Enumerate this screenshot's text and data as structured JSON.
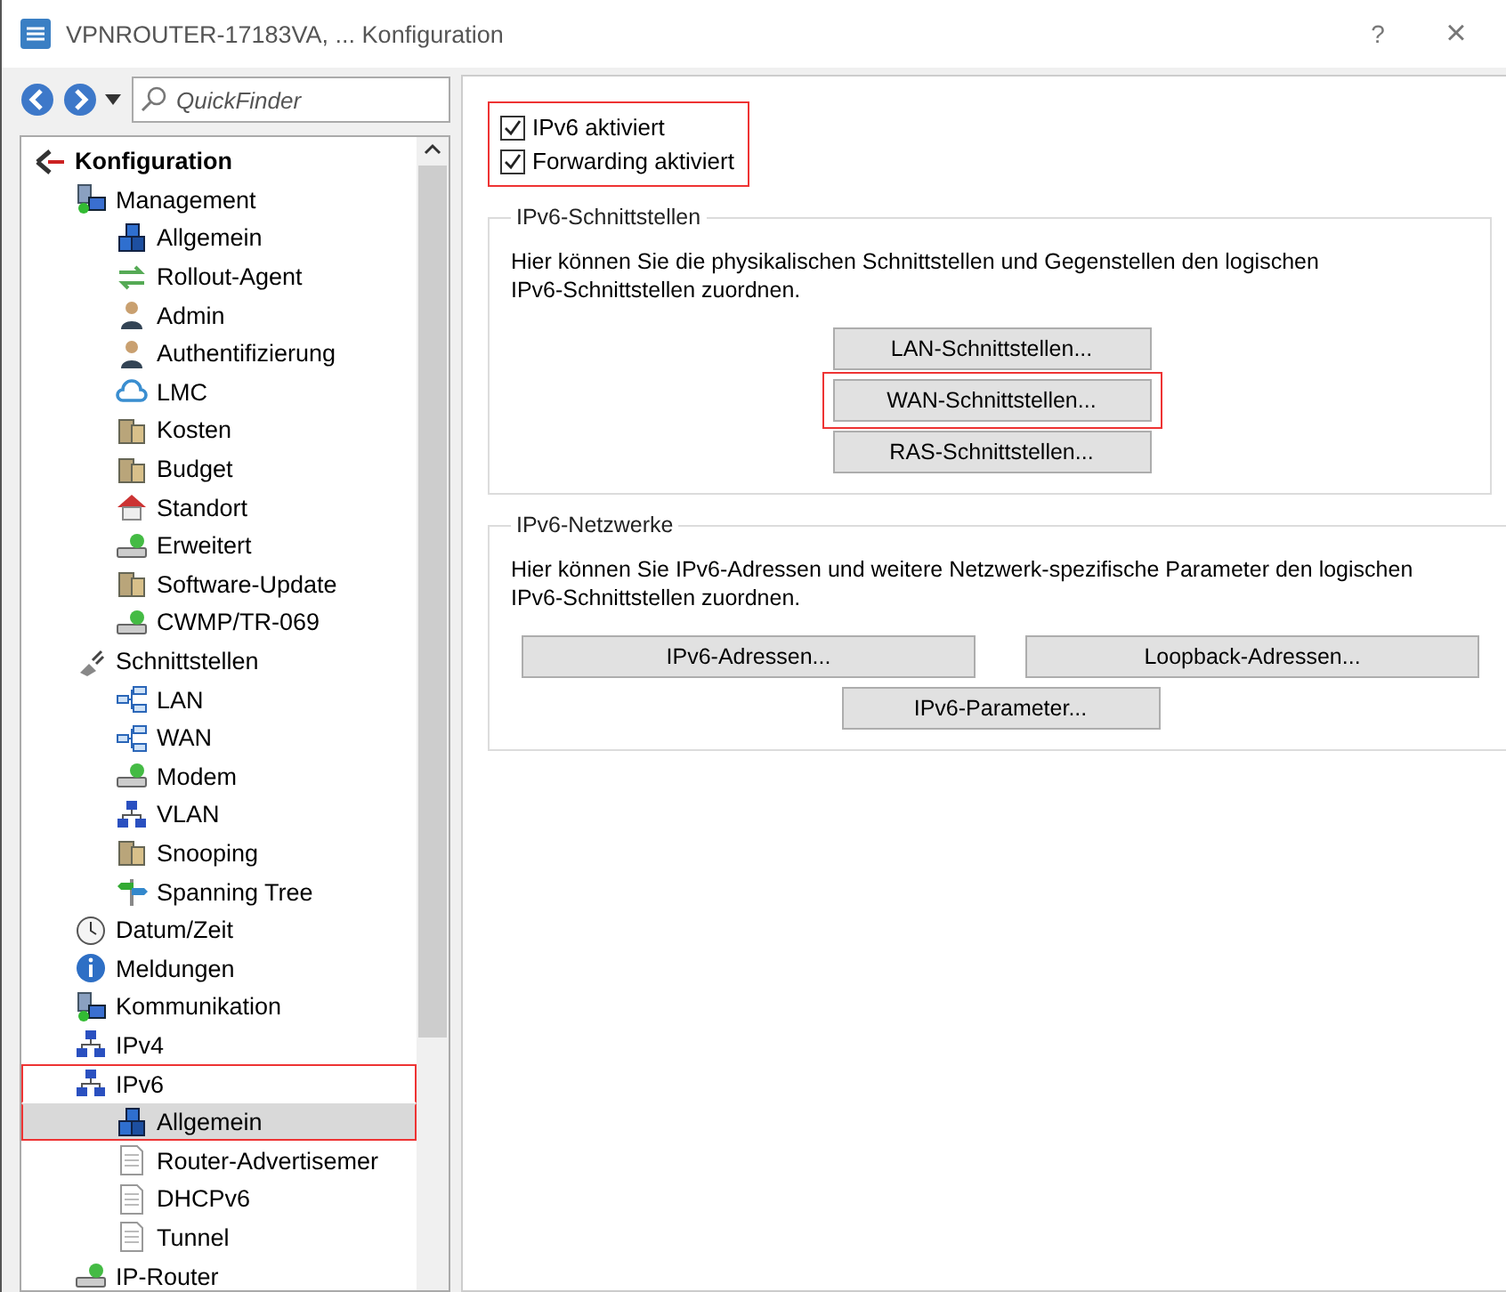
{
  "window": {
    "title": "VPNROUTER-17183VA, ... Konfiguration",
    "help": "?",
    "close": "×"
  },
  "quickfinder": {
    "placeholder": "QuickFinder"
  },
  "tree": [
    {
      "label": "Konfiguration",
      "kind": "root",
      "selected": false,
      "highlighted": false,
      "children": [
        {
          "label": "Management",
          "kind": "group",
          "selected": false,
          "highlighted": false,
          "children": [
            {
              "label": "Allgemein",
              "kind": "cubes",
              "selected": false,
              "highlighted": false
            },
            {
              "label": "Rollout-Agent",
              "kind": "arrows",
              "selected": false,
              "highlighted": false
            },
            {
              "label": "Admin",
              "kind": "user",
              "selected": false,
              "highlighted": false
            },
            {
              "label": "Authentifizierung",
              "kind": "user",
              "selected": false,
              "highlighted": false
            },
            {
              "label": "LMC",
              "kind": "cloud",
              "selected": false,
              "highlighted": false
            },
            {
              "label": "Kosten",
              "kind": "building",
              "selected": false,
              "highlighted": false
            },
            {
              "label": "Budget",
              "kind": "building",
              "selected": false,
              "highlighted": false
            },
            {
              "label": "Standort",
              "kind": "house",
              "selected": false,
              "highlighted": false
            },
            {
              "label": "Erweitert",
              "kind": "drive",
              "selected": false,
              "highlighted": false
            },
            {
              "label": "Software-Update",
              "kind": "building",
              "selected": false,
              "highlighted": false
            },
            {
              "label": "CWMP/TR-069",
              "kind": "drive",
              "selected": false,
              "highlighted": false
            }
          ]
        },
        {
          "label": "Schnittstellen",
          "kind": "plug",
          "selected": false,
          "highlighted": false,
          "children": [
            {
              "label": "LAN",
              "kind": "lan",
              "selected": false,
              "highlighted": false
            },
            {
              "label": "WAN",
              "kind": "lan",
              "selected": false,
              "highlighted": false
            },
            {
              "label": "Modem",
              "kind": "drive",
              "selected": false,
              "highlighted": false
            },
            {
              "label": "VLAN",
              "kind": "network",
              "selected": false,
              "highlighted": false
            },
            {
              "label": "Snooping",
              "kind": "building",
              "selected": false,
              "highlighted": false
            },
            {
              "label": "Spanning Tree",
              "kind": "signpost",
              "selected": false,
              "highlighted": false
            }
          ]
        },
        {
          "label": "Datum/Zeit",
          "kind": "clock",
          "selected": false,
          "highlighted": false
        },
        {
          "label": "Meldungen",
          "kind": "info",
          "selected": false,
          "highlighted": false
        },
        {
          "label": "Kommunikation",
          "kind": "group",
          "selected": false,
          "highlighted": false
        },
        {
          "label": "IPv4",
          "kind": "network",
          "selected": false,
          "highlighted": false
        },
        {
          "label": "IPv6",
          "kind": "network",
          "selected": false,
          "highlighted": true,
          "children": [
            {
              "label": "Allgemein",
              "kind": "cubes",
              "selected": true,
              "highlighted": true
            },
            {
              "label": "Router-Advertisemer",
              "kind": "doc",
              "selected": false,
              "highlighted": false
            },
            {
              "label": "DHCPv6",
              "kind": "doc",
              "selected": false,
              "highlighted": false
            },
            {
              "label": "Tunnel",
              "kind": "doc",
              "selected": false,
              "highlighted": false
            }
          ]
        },
        {
          "label": "IP-Router",
          "kind": "drive",
          "selected": false,
          "highlighted": false
        }
      ]
    }
  ],
  "options": {
    "highlighted": true,
    "items": [
      {
        "label": "IPv6 aktiviert",
        "checked": true
      },
      {
        "label": "Forwarding aktiviert",
        "checked": true
      }
    ]
  },
  "groups": [
    {
      "title": "IPv6-Schnittstellen",
      "description": "Hier können Sie die physikalischen Schnittstellen und Gegenstellen den logischen IPv6-Schnittstellen zuordnen.",
      "kind": "stack",
      "buttons": [
        {
          "label": "LAN-Schnittstellen...",
          "highlighted": false
        },
        {
          "label": "WAN-Schnittstellen...",
          "highlighted": true
        },
        {
          "label": "RAS-Schnittstellen...",
          "highlighted": false
        }
      ]
    },
    {
      "title": "IPv6-Netzwerke",
      "description": "Hier können Sie IPv6-Adressen und weitere Netzwerk-spezifische Parameter den logischen IPv6-Schnittstellen zuordnen.",
      "kind": "pair",
      "buttons": [
        {
          "label": "IPv6-Adressen...",
          "highlighted": false
        },
        {
          "label": "Loopback-Adressen...",
          "highlighted": false
        },
        {
          "label": "IPv6-Parameter...",
          "highlighted": false
        }
      ]
    }
  ]
}
